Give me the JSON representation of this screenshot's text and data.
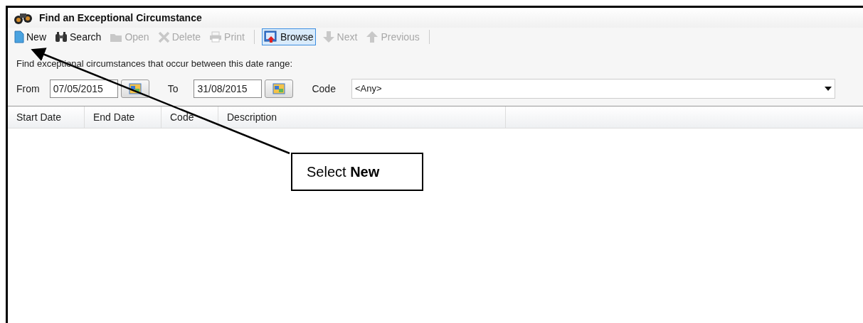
{
  "window": {
    "title": "Find an Exceptional Circumstance"
  },
  "toolbar": [
    {
      "label": "New",
      "disabled": false,
      "selected": false
    },
    {
      "label": "Search",
      "disabled": false,
      "selected": false
    },
    {
      "label": "Open",
      "disabled": true,
      "selected": false
    },
    {
      "label": "Delete",
      "disabled": true,
      "selected": false
    },
    {
      "label": "Print",
      "disabled": true,
      "selected": false
    },
    {
      "label": "Browse",
      "disabled": false,
      "selected": true
    },
    {
      "label": "Next",
      "disabled": true,
      "selected": false
    },
    {
      "label": "Previous",
      "disabled": true,
      "selected": false
    }
  ],
  "instruction": "Find exceptional circumstances that occur between this date range:",
  "filters": {
    "from_label": "From",
    "from_value": "07/05/2015",
    "to_label": "To",
    "to_value": "31/08/2015",
    "code_label": "Code",
    "code_value": "<Any>"
  },
  "table": {
    "columns": [
      "Start Date",
      "End Date",
      "Code",
      "Description"
    ]
  },
  "callout": {
    "text": "Select **New**"
  }
}
